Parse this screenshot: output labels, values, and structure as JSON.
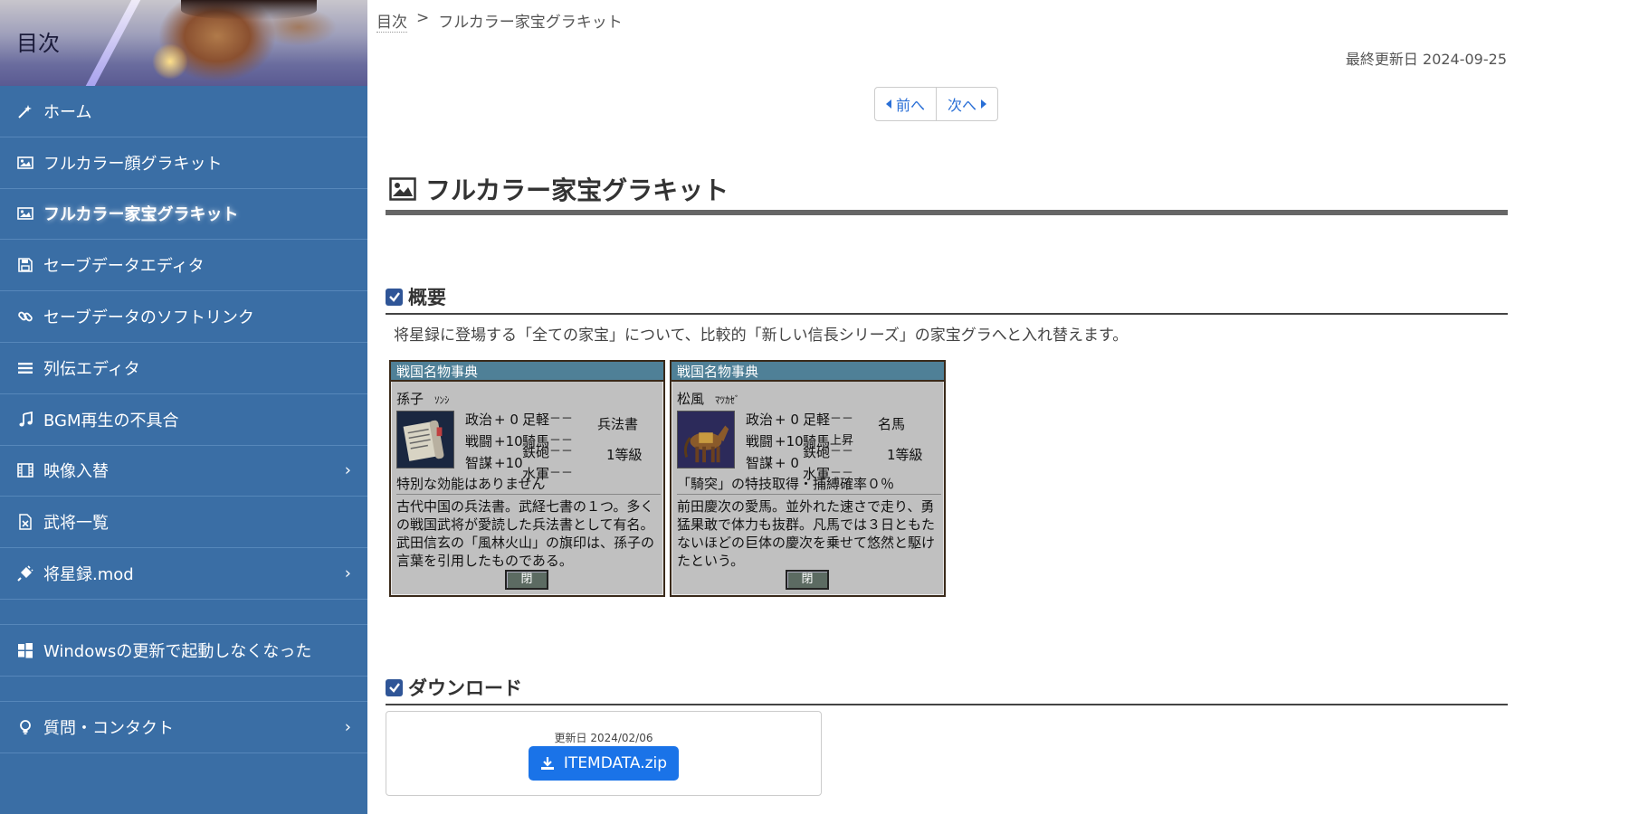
{
  "sidebar": {
    "title": "目次",
    "items": [
      {
        "label": "ホーム",
        "icon": "magic-wand-icon",
        "chevron": false,
        "active": false
      },
      {
        "label": "フルカラー顔グラキット",
        "icon": "image-icon",
        "chevron": false,
        "active": false
      },
      {
        "label": "フルカラー家宝グラキット",
        "icon": "image-icon",
        "chevron": false,
        "active": true
      },
      {
        "label": "セーブデータエディタ",
        "icon": "floppy-disk-icon",
        "chevron": false,
        "active": false
      },
      {
        "label": "セーブデータのソフトリンク",
        "icon": "link-icon",
        "chevron": false,
        "active": false
      },
      {
        "label": "列伝エディタ",
        "icon": "list-icon",
        "chevron": false,
        "active": false
      },
      {
        "label": "BGM再生の不具合",
        "icon": "music-note-icon",
        "chevron": false,
        "active": false
      },
      {
        "label": "映像入替",
        "icon": "film-icon",
        "chevron": true,
        "active": false
      },
      {
        "label": "武将一覧",
        "icon": "excel-file-icon",
        "chevron": false,
        "active": false
      },
      {
        "label": "将星録.mod",
        "icon": "plug-icon",
        "chevron": true,
        "active": false
      },
      {
        "label": "Windowsの更新で起動しなくなった",
        "icon": "windows-icon",
        "chevron": false,
        "active": false
      },
      {
        "label": "質問・コンタクト",
        "icon": "lightbulb-icon",
        "chevron": true,
        "active": false
      }
    ]
  },
  "breadcrumb": {
    "root": "目次",
    "separator": ">",
    "current": "フルカラー家宝グラキット"
  },
  "updated": "最終更新日 2024-09-25",
  "pager": {
    "prev": "前へ",
    "next": "次へ"
  },
  "page_title": "フルカラー家宝グラキット",
  "overview": {
    "heading": "概要",
    "text": "将星録に登場する「全ての家宝」について、比較的「新しい信長シリーズ」の家宝グラへと入れ替えます。"
  },
  "dialogs": [
    {
      "title": "戦国名物事典",
      "name": "孫子",
      "kana": "ｿﾝｼ",
      "stats": [
        {
          "label": "政治",
          "value": "+ 0"
        },
        {
          "label": "戦闘",
          "value": "+10"
        },
        {
          "label": "智謀",
          "value": "+10"
        }
      ],
      "units": [
        {
          "label": "足軽",
          "value": "－－"
        },
        {
          "label": "騎馬",
          "value": "－－"
        },
        {
          "label": "鉄砲",
          "value": "－－"
        },
        {
          "label": "水軍",
          "value": "－－"
        }
      ],
      "type": "兵法書",
      "grade": "1等級",
      "effect": "特別な効能はありません",
      "description": "古代中国の兵法書。武経七書の１つ。多くの戦国武将が愛読した兵法書として有名。武田信玄の「風林火山」の旗印は、孫子の言葉を引用したものである。",
      "close": "閉",
      "image": "scroll-book-icon"
    },
    {
      "title": "戦国名物事典",
      "name": "松風",
      "kana": "ﾏﾂｶｾﾞ",
      "stats": [
        {
          "label": "政治",
          "value": "+ 0"
        },
        {
          "label": "戦闘",
          "value": "+10"
        },
        {
          "label": "智謀",
          "value": "+ 0"
        }
      ],
      "units": [
        {
          "label": "足軽",
          "value": "－－"
        },
        {
          "label": "騎馬",
          "value": "上昇"
        },
        {
          "label": "鉄砲",
          "value": "－－"
        },
        {
          "label": "水軍",
          "value": "－－"
        }
      ],
      "type": "名馬",
      "grade": "1等級",
      "effect": "「騎突」の特技取得・捕縛確率０％",
      "description": "前田慶次の愛馬。並外れた速さで走り、勇猛果敢で体力も抜群。凡馬では３日ともたないほどの巨体の慶次を乗せて悠然と駆けたという。",
      "close": "閉",
      "image": "horse-icon"
    }
  ],
  "download": {
    "heading": "ダウンロード",
    "date": "更新日 2024/02/06",
    "button": "ITEMDATA.zip"
  },
  "colors": {
    "sidebar_bg": "#3a6ea5",
    "link": "#2a6fd6",
    "download_button": "#1a73e8",
    "dialog_title_bg": "#4f8097",
    "section_check": "#2f5597"
  }
}
